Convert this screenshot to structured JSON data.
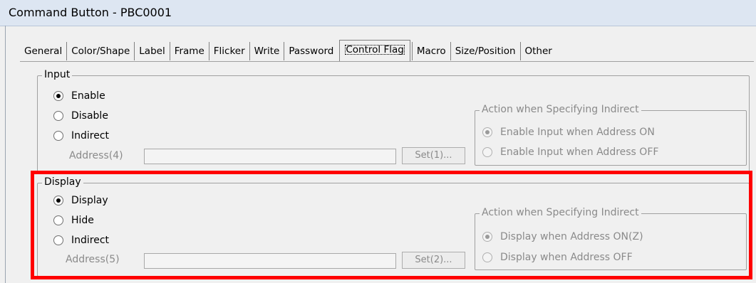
{
  "window": {
    "title": "Command Button - PBC0001"
  },
  "tabs": [
    {
      "label": "General"
    },
    {
      "label": "Color/Shape"
    },
    {
      "label": "Label"
    },
    {
      "label": "Frame"
    },
    {
      "label": "Flicker"
    },
    {
      "label": "Write"
    },
    {
      "label": "Password"
    },
    {
      "label": "Control Flag",
      "active": true
    },
    {
      "label": "Macro"
    },
    {
      "label": "Size/Position"
    },
    {
      "label": "Other"
    }
  ],
  "input_group": {
    "title": "Input",
    "options": [
      "Enable",
      "Disable",
      "Indirect"
    ],
    "selected": "Enable",
    "address_label": "Address(4)",
    "address_value": "",
    "set_button": "Set(1)...",
    "indirect_action": {
      "title": "Action when Specifying Indirect",
      "options": [
        "Enable Input when Address ON",
        "Enable Input when Address OFF"
      ],
      "selected": "Enable Input when Address ON"
    }
  },
  "display_group": {
    "title": "Display",
    "options": [
      "Display",
      "Hide",
      "Indirect"
    ],
    "selected": "Display",
    "address_label": "Address(5)",
    "address_value": "",
    "set_button": "Set(2)...",
    "indirect_action": {
      "title": "Action when Specifying Indirect",
      "options": [
        "Display when Address ON(Z)",
        "Display when Address OFF"
      ],
      "selected": "Display when Address ON(Z)"
    }
  },
  "highlight_color": "#ff0000"
}
